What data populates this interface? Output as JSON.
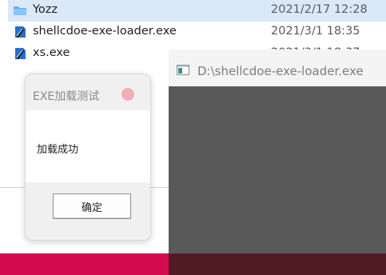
{
  "file_list": {
    "rows": [
      {
        "name": "Yozz",
        "date": "2021/2/17 12:28",
        "icon": "folder-icon",
        "selected": true
      },
      {
        "name": "shellcdoe-exe-loader.exe",
        "date": "2021/3/1 18:35",
        "icon": "exe-icon",
        "selected": false
      },
      {
        "name": "xs.exe",
        "date": "2021/3/1 18:37",
        "icon": "exe-icon",
        "selected": false
      }
    ]
  },
  "console": {
    "title": "D:\\shellcdoe-exe-loader.exe",
    "icon": "console-window-icon"
  },
  "msgbox": {
    "title": "EXE加载测试",
    "message": "加载成功",
    "ok_label": "确定",
    "close_icon": "close-icon"
  },
  "colors": {
    "selection": "#dbe8f8",
    "folder": "#6bb1f2",
    "console_body": "#595959",
    "pink_strip": "#d40a4e",
    "dark_strip": "#521a22",
    "close_button": "#f2aeb6"
  }
}
